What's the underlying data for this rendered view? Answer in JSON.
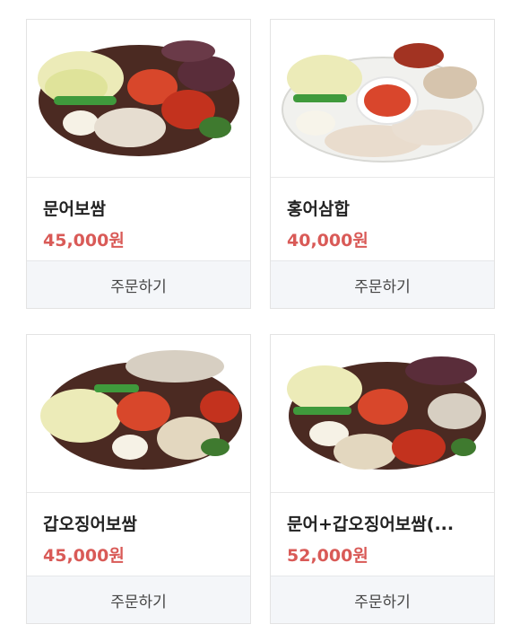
{
  "products": [
    {
      "name": "문어보쌈",
      "price": "45,000원",
      "order_label": "주문하기",
      "image": "octopus-bossam-platter"
    },
    {
      "name": "홍어삼합",
      "price": "40,000원",
      "order_label": "주문하기",
      "image": "skate-samhap-platter"
    },
    {
      "name": "갑오징어보쌈",
      "price": "45,000원",
      "order_label": "주문하기",
      "image": "cuttlefish-bossam-platter"
    },
    {
      "name": "문어+갑오징어보쌈(...",
      "price": "52,000원",
      "order_label": "주문하기",
      "image": "octopus-cuttlefish-bossam-platter"
    }
  ]
}
